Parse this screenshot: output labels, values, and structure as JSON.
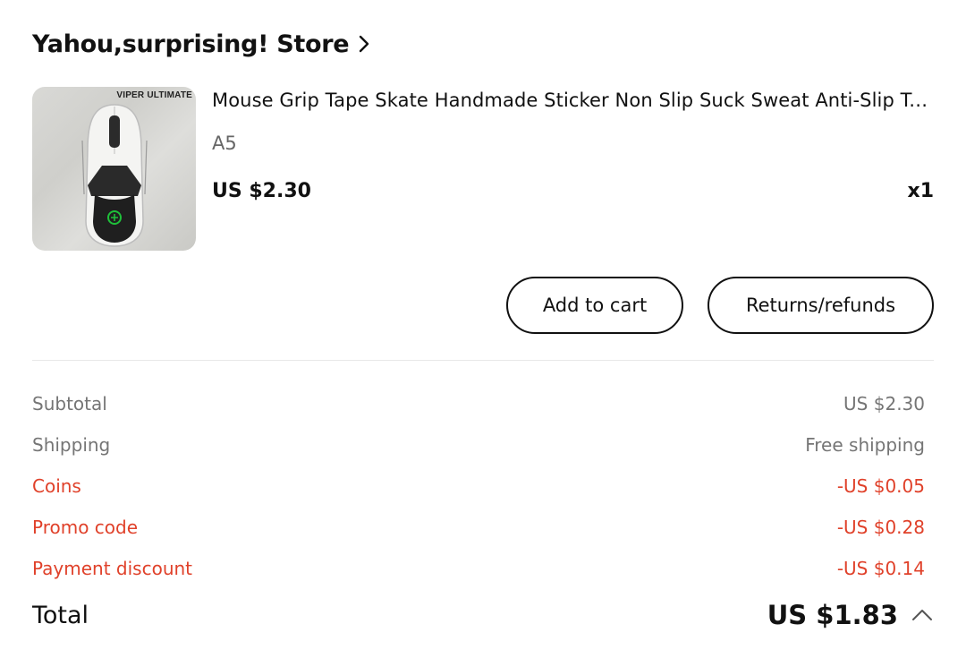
{
  "store": {
    "name": "Yahou,surprising! Store",
    "chevron_icon": "chevron-right-icon"
  },
  "item": {
    "image_caption": "VIPER ULTIMATE",
    "title": "Mouse Grip Tape Skate Handmade Sticker Non Slip Suck Sweat Anti-Slip Tape for Razer Viper Ultimate",
    "variant": "A5",
    "price": "US $2.30",
    "quantity": "x1"
  },
  "actions": {
    "add_to_cart": "Add to cart",
    "returns": "Returns/refunds"
  },
  "summary": {
    "subtotal_label": "Subtotal",
    "subtotal_value": "US $2.30",
    "shipping_label": "Shipping",
    "shipping_value": "Free shipping",
    "coins_label": "Coins",
    "coins_value": "-US $0.05",
    "promo_label": "Promo code",
    "promo_value": "-US $0.28",
    "payment_label": "Payment discount",
    "payment_value": "-US $0.14",
    "total_label": "Total",
    "total_value": "US $1.83",
    "toggle_icon": "chevron-up-icon"
  },
  "colors": {
    "discount": "#e0412a",
    "muted": "#757575",
    "text": "#111111"
  }
}
